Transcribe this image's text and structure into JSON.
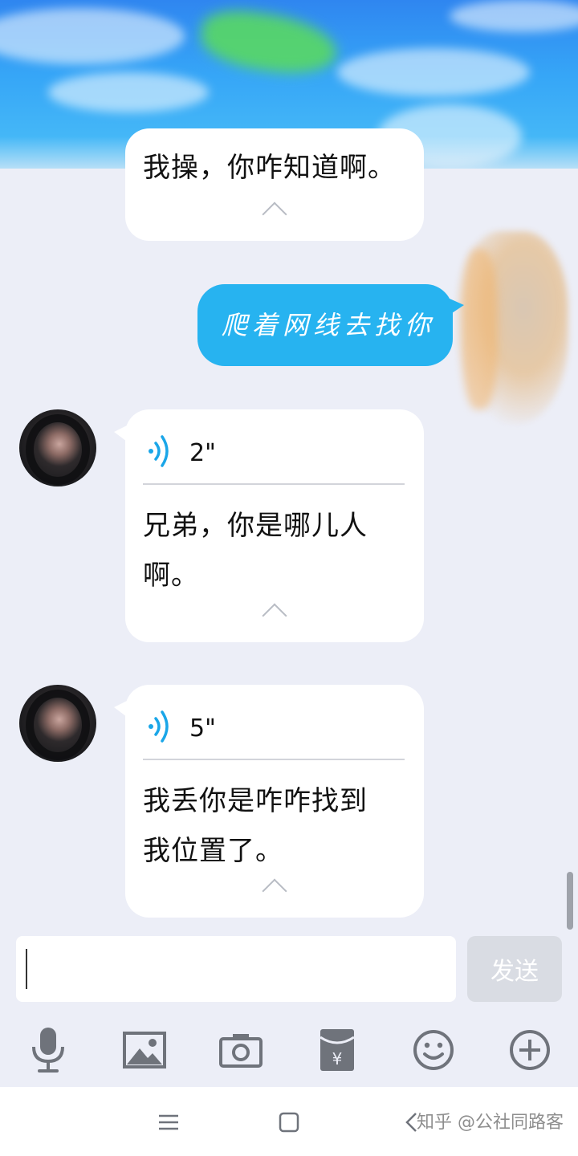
{
  "messages": [
    {
      "type": "text_in",
      "text_lines": [
        "我操，你咋知道啊。"
      ]
    },
    {
      "type": "text_out",
      "text": "爬着网线去找你"
    },
    {
      "type": "voice_in",
      "duration": "2\"",
      "text_lines": [
        "兄弟，你是哪儿人",
        "啊。"
      ]
    },
    {
      "type": "voice_in",
      "duration": "5\"",
      "text_lines": [
        "我丢你是咋咋找到",
        "我位置了。"
      ]
    }
  ],
  "composer": {
    "input_value": "",
    "send_label": "发送"
  },
  "toolbar": {
    "icons": [
      "microphone-icon",
      "image-icon",
      "camera-icon",
      "red-packet-icon",
      "emoji-icon",
      "plus-icon"
    ]
  },
  "watermark": "知乎 @公社同路客",
  "colors": {
    "accent": "#27b3f0",
    "background": "#eceef7",
    "voice_wave": "#1aa6e8",
    "icon_gray": "#6f737b"
  }
}
